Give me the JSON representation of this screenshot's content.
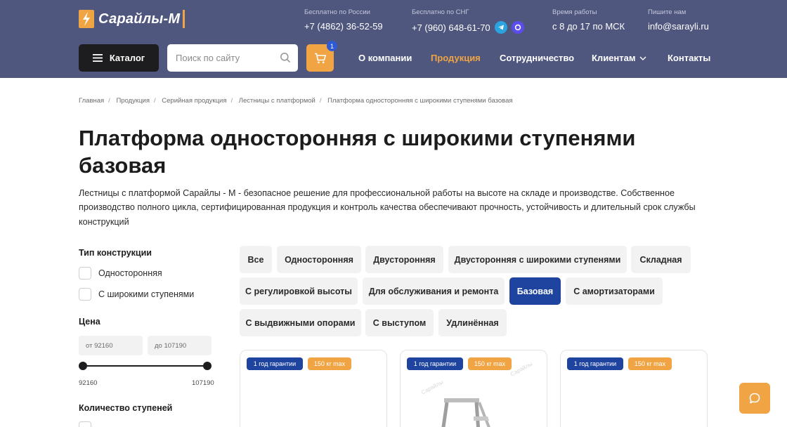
{
  "header": {
    "logo_text": "Сарайлы-М",
    "contacts": [
      {
        "label": "Бесплатно по России",
        "value": "+7 (4862) 36-52-59"
      },
      {
        "label": "Бесплатно по СНГ",
        "value": "+7 (960) 648-61-70"
      },
      {
        "label": "Время работы",
        "value": "с 8 до 17 по МСК"
      },
      {
        "label": "Пишите нам",
        "value": "info@sarayli.ru"
      }
    ],
    "catalog_label": "Каталог",
    "search_placeholder": "Поиск по сайту",
    "cart_count": "1",
    "nav": [
      {
        "label": "О компании",
        "active": false
      },
      {
        "label": "Продукция",
        "active": true
      },
      {
        "label": "Сотрудничество",
        "active": false
      },
      {
        "label": "Клиентам",
        "active": false
      },
      {
        "label": "Контакты",
        "active": false
      }
    ]
  },
  "breadcrumb": [
    "Главная",
    "Продукция",
    "Серийная продукция",
    "Лестницы с платформой",
    "Платформа односторонняя с широкими ступенями базовая"
  ],
  "page_title": "Платформа односторонняя с широкими ступенями базовая",
  "intro": "Лестницы с платформой Сарайлы - М - безопасное решение для профессиональной работы на высоте на складе и производстве. Собственное производство полного цикла, сертифицированная продукция и контроль качества обеспечивают прочность, устойчивость и длительный срок службы конструкций",
  "filters": {
    "construction_title": "Тип конструкции",
    "construction_options": [
      "Односторонняя",
      "С широкими ступенями"
    ],
    "price_title": "Цена",
    "price_from_placeholder": "от 92160",
    "price_to_placeholder": "до 107190",
    "price_min": "92160",
    "price_max": "107190",
    "steps_title": "Количество ступеней"
  },
  "chips": [
    {
      "label": "Все",
      "active": false
    },
    {
      "label": "Односторонняя",
      "active": false
    },
    {
      "label": "Двусторонняя",
      "active": false
    },
    {
      "label": "Двусторонняя с широкими ступенями",
      "active": false
    },
    {
      "label": "Складная",
      "active": false
    },
    {
      "label": "С регулировкой высоты",
      "active": false
    },
    {
      "label": "Для обслуживания и ремонта",
      "active": false
    },
    {
      "label": "Базовая",
      "active": true
    },
    {
      "label": "С амортизаторами",
      "active": false
    },
    {
      "label": "С выдвижными опорами",
      "active": false
    },
    {
      "label": "С выступом",
      "active": false
    },
    {
      "label": "Удлинённая",
      "active": false
    }
  ],
  "cards": [
    {
      "warranty_badge": "1 год гарантии",
      "load_badge": "150 кг max"
    },
    {
      "warranty_badge": "1 год гарантии",
      "load_badge": "150 кг max",
      "watermark": "Сарайлы"
    },
    {
      "warranty_badge": "1 год гарантии",
      "load_badge": "150 кг max"
    }
  ],
  "colors": {
    "header_bg": "#50577f",
    "accent_orange": "#f0a443",
    "active_blue": "#1f44a0",
    "catalog_dark": "#1d1d1f"
  }
}
